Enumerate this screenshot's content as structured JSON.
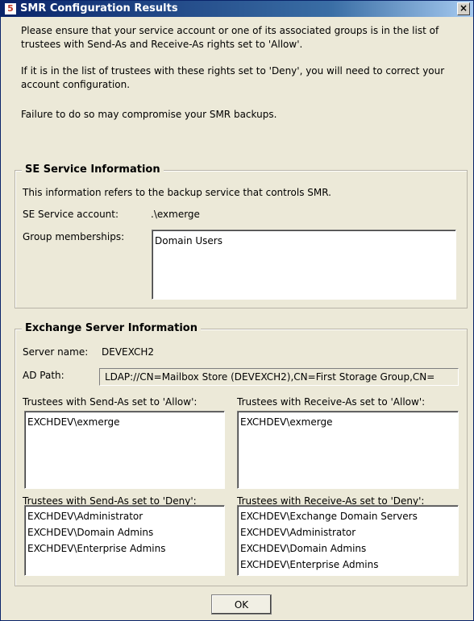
{
  "window": {
    "title": "SMR Configuration Results",
    "app_icon_text": "5",
    "close_symbol": "×"
  },
  "intro": {
    "p1": "Please ensure that your service account or one of its associated groups is in the list of trustees with Send-As and Receive-As rights set to 'Allow'.",
    "p2": "If it is in the list of trustees with these rights set to 'Deny', you will need to correct your account configuration.",
    "p3": "Failure to do so may compromise your SMR backups."
  },
  "se_service": {
    "legend": "SE Service Information",
    "description": "This information refers to the backup service that controls SMR.",
    "account_label": "SE Service account:",
    "account_value": ".\\exmerge",
    "groups_label": "Group memberships:",
    "groups": [
      "Domain Users"
    ]
  },
  "exchange": {
    "legend": "Exchange Server Information",
    "server_label": "Server name:",
    "server_value": "DEVEXCH2",
    "adpath_label": "AD Path:",
    "adpath_value": "LDAP://CN=Mailbox Store (DEVEXCH2),CN=First Storage Group,CN=",
    "send_allow_label": "Trustees with Send-As set to 'Allow':",
    "send_allow": [
      "EXCHDEV\\exmerge"
    ],
    "receive_allow_label": "Trustees with Receive-As set to 'Allow':",
    "receive_allow": [
      "EXCHDEV\\exmerge"
    ],
    "send_deny_label": "Trustees with Send-As set to 'Deny':",
    "send_deny": [
      "EXCHDEV\\Administrator",
      "EXCHDEV\\Domain Admins",
      "EXCHDEV\\Enterprise Admins"
    ],
    "receive_deny_label": "Trustees with Receive-As set to 'Deny':",
    "receive_deny": [
      "EXCHDEV\\Exchange Domain Servers",
      "EXCHDEV\\Administrator",
      "EXCHDEV\\Domain Admins",
      "EXCHDEV\\Enterprise Admins"
    ]
  },
  "buttons": {
    "ok": "OK"
  }
}
